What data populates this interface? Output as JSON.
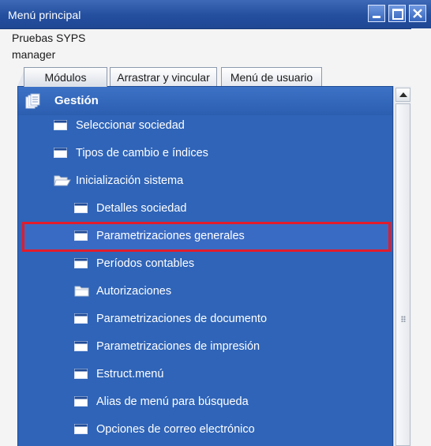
{
  "window": {
    "title": "Menú principal"
  },
  "session": {
    "company": "Pruebas SYPS",
    "user": "manager"
  },
  "tabs": [
    {
      "label": "Módulos",
      "active": true
    },
    {
      "label": "Arrastrar y vincular",
      "active": false
    },
    {
      "label": "Menú de usuario",
      "active": false
    }
  ],
  "module": {
    "label": "Gestión",
    "icon": "document-stack-icon"
  },
  "menu_items": [
    {
      "label": "Seleccionar sociedad",
      "icon": "window-icon",
      "level": 1
    },
    {
      "label": "Tipos de cambio e índices",
      "icon": "window-icon",
      "level": 1
    },
    {
      "label": "Inicialización sistema",
      "icon": "folder-open-icon",
      "level": 1
    },
    {
      "label": "Detalles sociedad",
      "icon": "window-icon",
      "level": 2
    },
    {
      "label": "Parametrizaciones generales",
      "icon": "window-icon",
      "level": 2,
      "highlighted": true
    },
    {
      "label": "Períodos contables",
      "icon": "window-icon",
      "level": 2
    },
    {
      "label": "Autorizaciones",
      "icon": "folder-icon",
      "level": 2
    },
    {
      "label": "Parametrizaciones de documento",
      "icon": "window-icon",
      "level": 2
    },
    {
      "label": "Parametrizaciones de impresión",
      "icon": "window-icon",
      "level": 2
    },
    {
      "label": "Estruct.menú",
      "icon": "window-icon",
      "level": 2
    },
    {
      "label": "Alias de menú para búsqueda",
      "icon": "window-icon",
      "level": 2
    },
    {
      "label": "Opciones de correo electrónico",
      "icon": "window-icon",
      "level": 2
    }
  ],
  "colors": {
    "titlebar": "#244f9f",
    "panel": "#2f64b8",
    "highlight_border": "#e21c2c"
  }
}
